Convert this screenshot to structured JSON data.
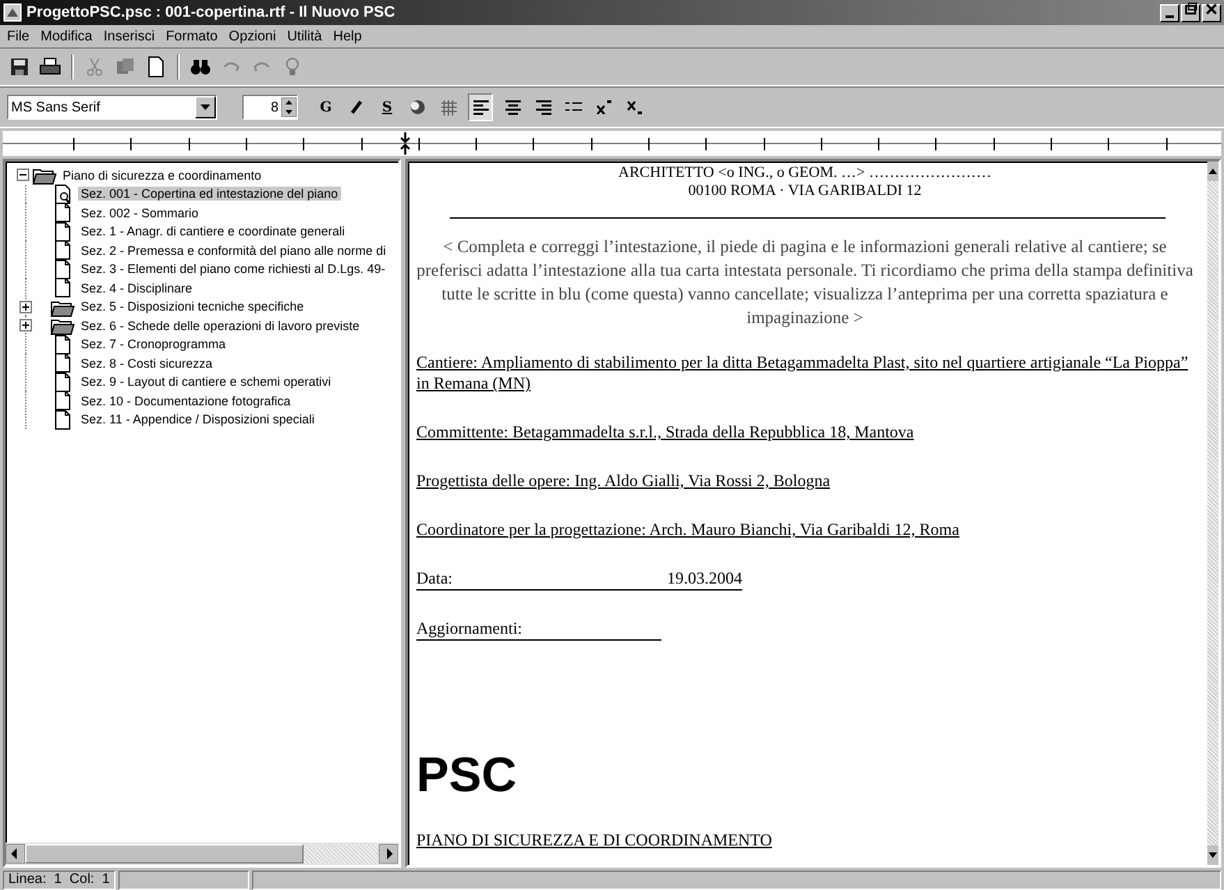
{
  "window": {
    "title": "ProgettoPSC.psc : 001-copertina.rtf - Il Nuovo PSC"
  },
  "menu": [
    "File",
    "Modifica",
    "Inserisci",
    "Formato",
    "Opzioni",
    "Utilità",
    "Help"
  ],
  "toolbar": [
    {
      "kind": "save"
    },
    {
      "kind": "print"
    },
    {
      "kind": "sep"
    },
    {
      "kind": "cut"
    },
    {
      "kind": "copy"
    },
    {
      "kind": "new"
    },
    {
      "kind": "sep"
    },
    {
      "kind": "find"
    },
    {
      "kind": "undo"
    },
    {
      "kind": "redo"
    },
    {
      "kind": "help"
    }
  ],
  "format_bar": {
    "font": "MS Sans Serif",
    "size": "8",
    "bold": "G",
    "underline": "S",
    "align": [
      {
        "kind": "left",
        "selected": true
      },
      {
        "kind": "center",
        "selected": false
      },
      {
        "kind": "right",
        "selected": false
      }
    ]
  },
  "tree": {
    "label": "Piano di sicurezza e coordinamento",
    "expanded": true,
    "children": [
      {
        "label": "Sez. 001 - Copertina ed intestazione del piano",
        "kind": "preview",
        "selected": true
      },
      {
        "label": "Sez. 002 - Sommario",
        "kind": "doc",
        "selected": false
      },
      {
        "label": "Sez. 1 - Anagr. di cantiere e coordinate generali",
        "kind": "doc",
        "selected": false
      },
      {
        "label": "Sez. 2 - Premessa e conformità del piano alle norme di",
        "kind": "doc",
        "selected": false
      },
      {
        "label": "Sez. 3 - Elementi del piano come richiesti al D.Lgs. 49-",
        "kind": "doc",
        "selected": false
      },
      {
        "label": "Sez. 4 - Disciplinare",
        "kind": "doc",
        "selected": false
      },
      {
        "label": "Sez. 5 - Disposizioni tecniche specifiche",
        "kind": "folder",
        "expanded": false,
        "selected": false
      },
      {
        "label": "Sez. 6 - Schede delle operazioni di lavoro previste",
        "kind": "folder",
        "expanded": false,
        "selected": false
      },
      {
        "label": "Sez. 7 - Cronoprogramma",
        "kind": "doc",
        "selected": false
      },
      {
        "label": "Sez. 8 - Costi sicurezza",
        "kind": "doc",
        "selected": false
      },
      {
        "label": "Sez. 9 - Layout di cantiere e schemi operativi",
        "kind": "doc",
        "selected": false
      },
      {
        "label": "Sez. 10 - Documentazione fotografica",
        "kind": "doc",
        "selected": false
      },
      {
        "label": "Sez. 11 - Appendice / Disposizioni speciali",
        "kind": "doc",
        "selected": false
      }
    ]
  },
  "document": [
    {
      "kind": "header",
      "text": "ARCHITETTO <o ING., o GEOM. …> ……………………"
    },
    {
      "kind": "header",
      "text": "00100 ROMA · VIA GARIBALDI 12"
    },
    {
      "kind": "rule"
    },
    {
      "kind": "note",
      "text": "< Completa e correggi l’intestazione, il piede di pagina e le informazioni generali relative al cantiere; se preferisci adatta l’intestazione alla tua carta intestata personale. Ti ricordiamo che prima della stampa definitiva tutte le scritte in blu (come questa) vanno cancellate; visualizza l’anteprima per una corretta spaziatura e impaginazione >"
    },
    {
      "kind": "field",
      "text": "Cantiere: Ampliamento di stabilimento per la ditta Betagammadelta Plast, sito nel quartiere artigianale “La Pioppa” in Remana (MN)"
    },
    {
      "kind": "field",
      "text": "Committente: Betagammadelta s.r.l., Strada della Repubblica 18, Mantova"
    },
    {
      "kind": "field",
      "text": "Progettista delle opere: Ing. Aldo Gialli, Via Rossi 2, Bologna"
    },
    {
      "kind": "field",
      "text": "Coordinatore per la progettazione: Arch. Mauro Bianchi, Via Garibaldi 12, Roma"
    },
    {
      "kind": "dated",
      "label": "Data:",
      "value": "19.03.2004"
    },
    {
      "kind": "blank",
      "label": "Aggiornamenti:"
    },
    {
      "kind": "title",
      "text": "PSC"
    },
    {
      "kind": "field",
      "text": "PIANO DI SICUREZZA E DI COORDINAMENTO"
    }
  ],
  "status_bar": [
    "Linea:  1  Col:  1"
  ]
}
